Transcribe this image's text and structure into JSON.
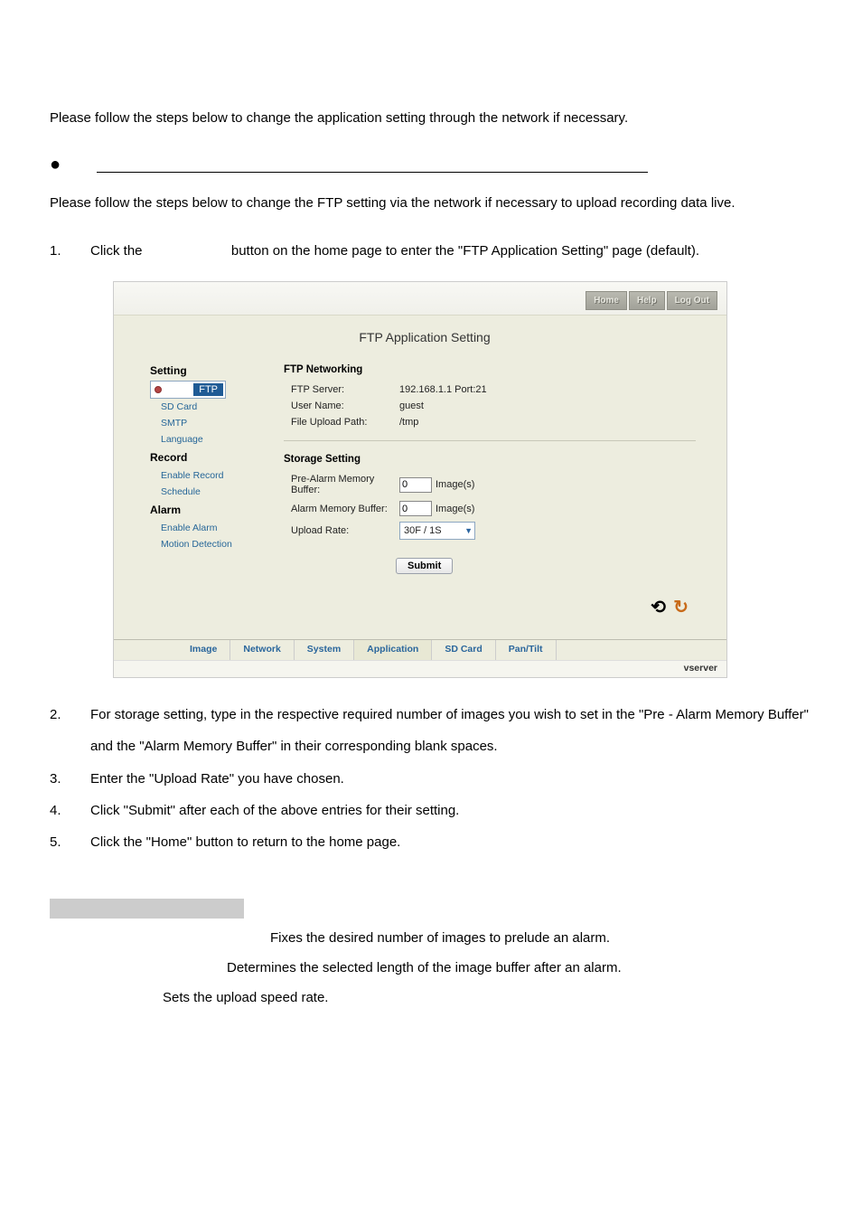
{
  "intro1": "Please follow the steps below to change the application setting through the network if necessary.",
  "intro2": "Please follow the steps below to change the FTP setting via the network if necessary to upload recording data live.",
  "steps": {
    "s1a": "Click the ",
    "s1b": " button on the home page to enter the \"FTP Application Setting\" page (default).",
    "s2": "For storage setting, type in the respective required number of images you wish to set in the \"Pre - Alarm Memory Buffer\" and the \"Alarm Memory Buffer\" in their corresponding blank spaces.",
    "s3": "Enter the \"Upload Rate\" you have chosen.",
    "s4": "Click \"Submit\" after each of the above entries for their setting.",
    "s5": "Click the \"Home\" button to return to the home page."
  },
  "app": {
    "top": {
      "home": "Home",
      "help": "Help",
      "logout": "Log Out"
    },
    "title": "FTP Application Setting",
    "sidebar": {
      "setting": "Setting",
      "ftp": "FTP",
      "sdcard": "SD Card",
      "smtp": "SMTP",
      "language": "Language",
      "record": "Record",
      "enrec": "Enable Record",
      "sched": "Schedule",
      "alarm": "Alarm",
      "enalarm": "Enable Alarm",
      "motion": "Motion Detection"
    },
    "section1": {
      "head": "FTP Networking",
      "srv_l": "FTP Server:",
      "srv_v": "192.168.1.1 Port:21",
      "usr_l": "User Name:",
      "usr_v": "guest",
      "pth_l": "File Upload Path:",
      "pth_v": "/tmp"
    },
    "section2": {
      "head": "Storage Setting",
      "pre_l": "Pre-Alarm Memory Buffer:",
      "pre_v": "0",
      "pre_u": "Image(s)",
      "al_l": "Alarm Memory Buffer:",
      "al_v": "0",
      "al_u": "Image(s)",
      "rate_l": "Upload Rate:",
      "rate_v": "30F / 1S",
      "submit": "Submit"
    },
    "tabs": {
      "image": "Image",
      "network": "Network",
      "system": "System",
      "application": "Application",
      "sdcard": "SD Card",
      "pantilt": "Pan/Tilt"
    },
    "brand": "vserver"
  },
  "desc": {
    "d1": "Fixes the desired number of images to prelude an alarm.",
    "d2": "Determines the selected length of the image buffer after an alarm.",
    "d3": "Sets the upload speed rate."
  },
  "nums": {
    "n1": "1.",
    "n2": "2.",
    "n3": "3.",
    "n4": "4.",
    "n5": "5."
  }
}
